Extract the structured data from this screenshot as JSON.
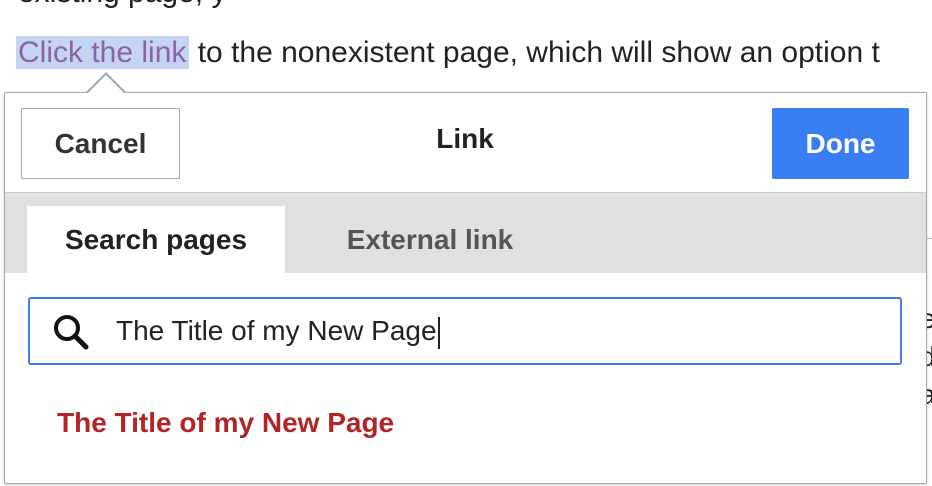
{
  "article": {
    "top_partial": "existing page, y",
    "link_text": "Click the link",
    "rest_text": " to the nonexistent page, which will show an option t",
    "right_fragments": [
      "e",
      "d",
      "a"
    ]
  },
  "dialog": {
    "title": "Link",
    "cancel_label": "Cancel",
    "done_label": "Done",
    "tabs": [
      {
        "label": "Search pages",
        "active": true
      },
      {
        "label": "External link",
        "active": false
      }
    ],
    "search": {
      "icon": "search-icon",
      "value": "The Title of my New Page"
    },
    "results": [
      {
        "label": "The Title of my New Page"
      }
    ]
  },
  "colors": {
    "accent": "#3a7ef3",
    "redlink": "#b32424",
    "link_highlight": "#c5d4f3",
    "visited_link": "#8a63a8"
  }
}
